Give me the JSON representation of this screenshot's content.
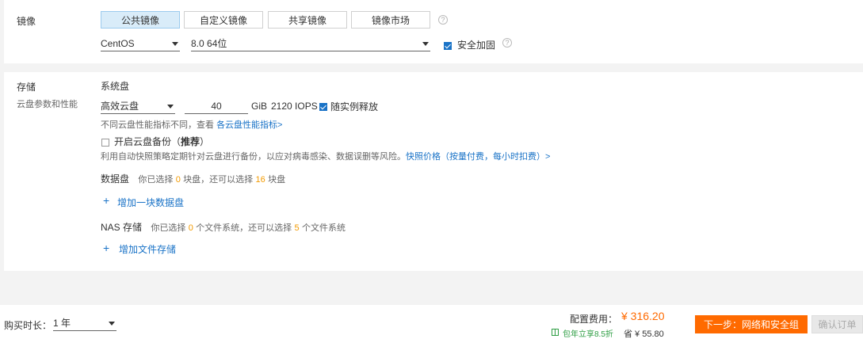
{
  "image": {
    "label": "镜像",
    "tabs": [
      "公共镜像",
      "自定义镜像",
      "共享镜像",
      "镜像市场"
    ],
    "active_tab": 0,
    "os_select": "CentOS",
    "version_select": "8.0 64位",
    "security_label": "安全加固"
  },
  "storage": {
    "label": "存储",
    "sublabel": "云盘参数和性能",
    "system_disk": {
      "title": "系统盘",
      "type_select": "高效云盘",
      "size_value": "40",
      "unit": "GiB",
      "iops": "2120 IOPS",
      "release_label": "随实例释放",
      "perf_note": "不同云盘性能指标不同，查看",
      "perf_link": "各云盘性能指标>"
    },
    "backup": {
      "label_prefix": "开启云盘备份（",
      "label_bold": "推荐",
      "label_suffix": "）",
      "desc": "利用自动快照策略定期针对云盘进行备份，以应对病毒感染、数据误删等风险。",
      "desc_link": "快照价格（按量付费，每小时扣费）>"
    },
    "data_disk": {
      "title": "数据盘",
      "text1": "你已选择",
      "selected": "0",
      "text2": "块盘，还可以选择",
      "remaining": "16",
      "text3": "块盘",
      "add_label": "增加一块数据盘"
    },
    "nas": {
      "title": "NAS 存储",
      "text1": "你已选择",
      "selected": "0",
      "text2": "个文件系统，还可以选择",
      "remaining": "5",
      "text3": "个文件系统",
      "add_label": "增加文件存储"
    }
  },
  "footer": {
    "duration_label": "购买时长：",
    "duration_value": "1 年",
    "cost_label": "配置费用：",
    "cost_value": "¥ 316.20",
    "discount_label": "包年立享8.5折",
    "save_label": "省 ¥ 55.80",
    "next_button": "下一步：网络和安全组",
    "confirm_button": "确认订单"
  }
}
